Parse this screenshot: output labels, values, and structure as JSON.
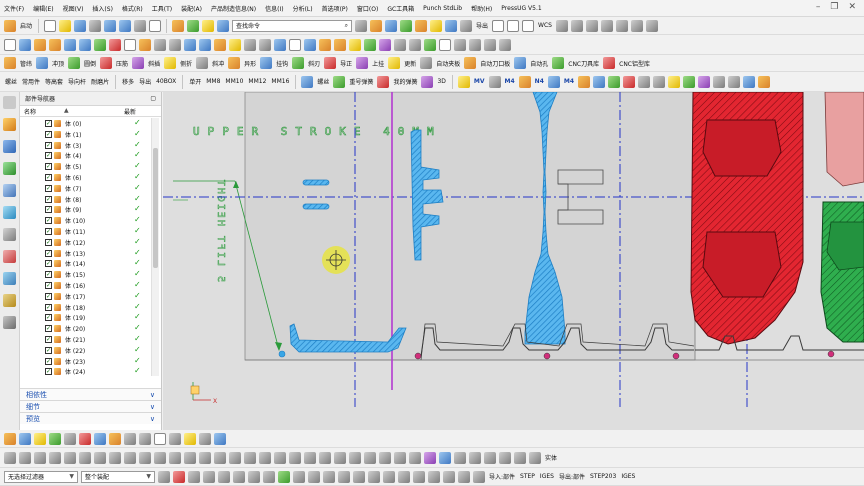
{
  "menu": [
    "文件(F)",
    "编辑(E)",
    "视图(V)",
    "插入(S)",
    "格式(R)",
    "工具(T)",
    "装配(A)",
    "产品制造信息(N)",
    "信息(I)",
    "分析(L)",
    "首选项(P)",
    "窗口(O)",
    "GC工具箱",
    "Punch StdLib",
    "帮助(H)",
    "PressUG V5.1"
  ],
  "toolbar1": {
    "start_label": "启动",
    "command_finder_placeholder": "查找命令",
    "export_label": "导出",
    "wcs_label": "WCS"
  },
  "toolbar3": [
    "管纬",
    "冲顶",
    "圆倒",
    "压筋",
    "斜插",
    "侧折",
    "斜冲",
    "异形",
    "挂钩",
    "斜刃",
    "导正",
    "上挂",
    "更新",
    "自动夹板",
    "自动刀口板",
    "自动孔",
    "CNC刀具库",
    "CNC铝型库"
  ],
  "toolbar4": [
    "螺丝",
    "常用件",
    "等高套",
    "导向杆",
    "耐磨片",
    "移多",
    "导出",
    "40BOX",
    "单开",
    "MM8",
    "MM10",
    "MM12",
    "MM16",
    "螺丝",
    "重号弹簧",
    "我的弹簧",
    "3D",
    "MV",
    "M4",
    "N4",
    "M4"
  ],
  "navigator": {
    "title": "部件导航器",
    "col_name": "名称",
    "col_latest": "最新",
    "bodies": [
      "体 (0)",
      "体 (1)",
      "体 (3)",
      "体 (4)",
      "体 (5)",
      "体 (6)",
      "体 (7)",
      "体 (8)",
      "体 (9)",
      "体 (10)",
      "体 (11)",
      "体 (12)",
      "体 (13)",
      "体 (14)",
      "体 (15)",
      "体 (16)",
      "体 (17)",
      "体 (18)",
      "体 (19)",
      "体 (20)",
      "体 (21)",
      "体 (22)",
      "体 (23)",
      "体 (24)"
    ],
    "sections": [
      "相依性",
      "细节",
      "预览"
    ]
  },
  "canvas": {
    "upper_stroke_text": "UPPER STROKE 40MM",
    "lift_height_text": "5 LIFT HEIGHT",
    "axis_label": "X"
  },
  "bottom": {
    "filter_label": "无选择过滤器",
    "assembly_label": "整个装配",
    "solid_label": "实体",
    "import_labels": [
      "导入:部件",
      "STEP",
      "IGES"
    ],
    "export_labels": [
      "导出:部件",
      "STEP203",
      "IGES"
    ]
  },
  "colors": {
    "canvas_bg": "#dcdcdc",
    "part_outline": "#3a3a3a",
    "hatch_blue": "#39a6e6",
    "die_red": "#e0202c",
    "die_green": "#2aa84a",
    "center_line": "#2535c8",
    "stroke_line": "#b33ad0",
    "cursor_yellow": "#e6e24a"
  }
}
